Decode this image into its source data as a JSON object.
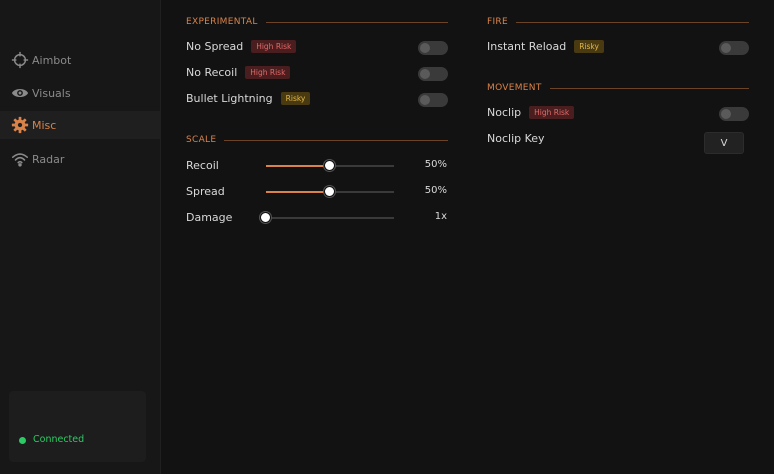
{
  "sidebar": {
    "items": [
      {
        "label": "Aimbot",
        "icon": "crosshair-icon",
        "active": false
      },
      {
        "label": "Visuals",
        "icon": "eye-icon",
        "active": false
      },
      {
        "label": "Misc",
        "icon": "gear-icon",
        "active": true
      },
      {
        "label": "Radar",
        "icon": "wifi-icon",
        "active": false
      }
    ],
    "status": {
      "text": "Connected",
      "color": "#2ec964"
    }
  },
  "experimental": {
    "title": "EXPERIMENTAL",
    "rows": [
      {
        "label": "No Spread",
        "badge": "High Risk",
        "badge_type": "high",
        "enabled": false
      },
      {
        "label": "No Recoil",
        "badge": "High Risk",
        "badge_type": "high",
        "enabled": false
      },
      {
        "label": "Bullet Lightning",
        "badge": "Risky",
        "badge_type": "risky",
        "enabled": false
      }
    ]
  },
  "scale": {
    "title": "SCALE",
    "sliders": [
      {
        "label": "Recoil",
        "value": "50%",
        "fraction": 0.5
      },
      {
        "label": "Spread",
        "value": "50%",
        "fraction": 0.5
      },
      {
        "label": "Damage",
        "value": "1x",
        "fraction": 0.0
      }
    ]
  },
  "fire": {
    "title": "FIRE",
    "rows": [
      {
        "label": "Instant Reload",
        "badge": "Risky",
        "badge_type": "risky",
        "enabled": false
      }
    ]
  },
  "movement": {
    "title": "MOVEMENT",
    "rows": [
      {
        "label": "Noclip",
        "badge": "High Risk",
        "badge_type": "high",
        "enabled": false
      }
    ],
    "key_label": "Noclip Key",
    "key_value": "V"
  },
  "colors": {
    "accent": "#d9834a",
    "high_risk": "#e06a6a",
    "risky": "#e0b84a"
  }
}
